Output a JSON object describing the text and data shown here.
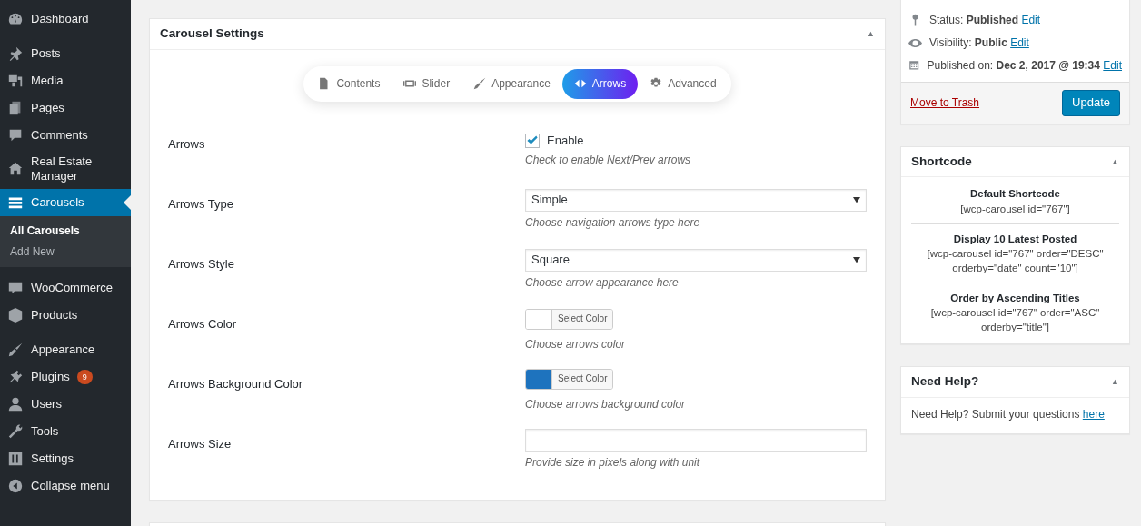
{
  "sidebar": {
    "groups": [
      {
        "items": [
          {
            "label": "Dashboard",
            "selected": false
          }
        ]
      },
      {
        "items": [
          {
            "label": "Posts",
            "selected": false
          },
          {
            "label": "Media",
            "selected": false
          },
          {
            "label": "Pages",
            "selected": false
          },
          {
            "label": "Comments",
            "selected": false
          },
          {
            "label": "Real Estate Manager",
            "selected": false
          },
          {
            "label": "Carousels",
            "selected": true,
            "children": [
              {
                "label": "All Carousels",
                "selected": true
              },
              {
                "label": "Add New",
                "selected": false
              }
            ]
          }
        ]
      },
      {
        "items": [
          {
            "label": "WooCommerce",
            "selected": false
          },
          {
            "label": "Products",
            "selected": false
          }
        ]
      },
      {
        "items": [
          {
            "label": "Appearance",
            "selected": false
          },
          {
            "label": "Plugins",
            "selected": false,
            "badge": "9"
          },
          {
            "label": "Users",
            "selected": false
          },
          {
            "label": "Tools",
            "selected": false
          },
          {
            "label": "Settings",
            "selected": false
          },
          {
            "label": "Collapse menu",
            "selected": false
          }
        ]
      }
    ]
  },
  "settings_panel": {
    "title": "Carousel Settings",
    "toggle": "▲",
    "tabs": [
      {
        "label": "Contents",
        "selected": false
      },
      {
        "label": "Slider",
        "selected": false
      },
      {
        "label": "Appearance",
        "selected": false
      },
      {
        "label": "Arrows",
        "selected": true
      },
      {
        "label": "Advanced",
        "selected": false
      }
    ],
    "fields": [
      {
        "kind": "checkbox",
        "label": "Arrows",
        "option": "Enable",
        "checked": true,
        "help": "Check to enable Next/Prev arrows"
      },
      {
        "kind": "select",
        "label": "Arrows Type",
        "value": "Simple",
        "help": "Choose navigation arrows type here"
      },
      {
        "kind": "select",
        "label": "Arrows Style",
        "value": "Square",
        "help": "Choose arrow appearance here"
      },
      {
        "kind": "color",
        "label": "Arrows Color",
        "button": "Select Color",
        "color": "#ffffff",
        "help": "Choose arrows color"
      },
      {
        "kind": "color",
        "label": "Arrows Background Color",
        "button": "Select Color",
        "color": "#1e73be",
        "help": "Choose arrows background color"
      },
      {
        "kind": "text",
        "label": "Arrows Size",
        "help": "Provide size in pixels along with unit"
      }
    ]
  },
  "publish_box": {
    "lines": [
      {
        "label": "Status:",
        "value": "Published",
        "link": "Edit"
      },
      {
        "label": "Visibility:",
        "value": "Public",
        "link": "Edit"
      },
      {
        "label": "Published on:",
        "value": "Dec 2, 2017 @ 19:34",
        "link": "Edit"
      }
    ],
    "trash_link": "Move to Trash",
    "update_button": "Update"
  },
  "shortcode_panel": {
    "title": "Shortcode",
    "toggle": "▲",
    "entries": [
      {
        "title": "Default Shortcode",
        "code": "[wcp-carousel id=\"767\"]"
      },
      {
        "title": "Display 10 Latest Posted",
        "code": "[wcp-carousel id=\"767\" order=\"DESC\" orderby=\"date\" count=\"10\"]"
      },
      {
        "title": "Order by Ascending Titles",
        "code": "[wcp-carousel id=\"767\" order=\"ASC\" orderby=\"title\"]"
      }
    ]
  },
  "help_panel": {
    "title": "Need Help?",
    "toggle": "▲",
    "text": "Need Help? Submit your questions",
    "link": "here"
  }
}
